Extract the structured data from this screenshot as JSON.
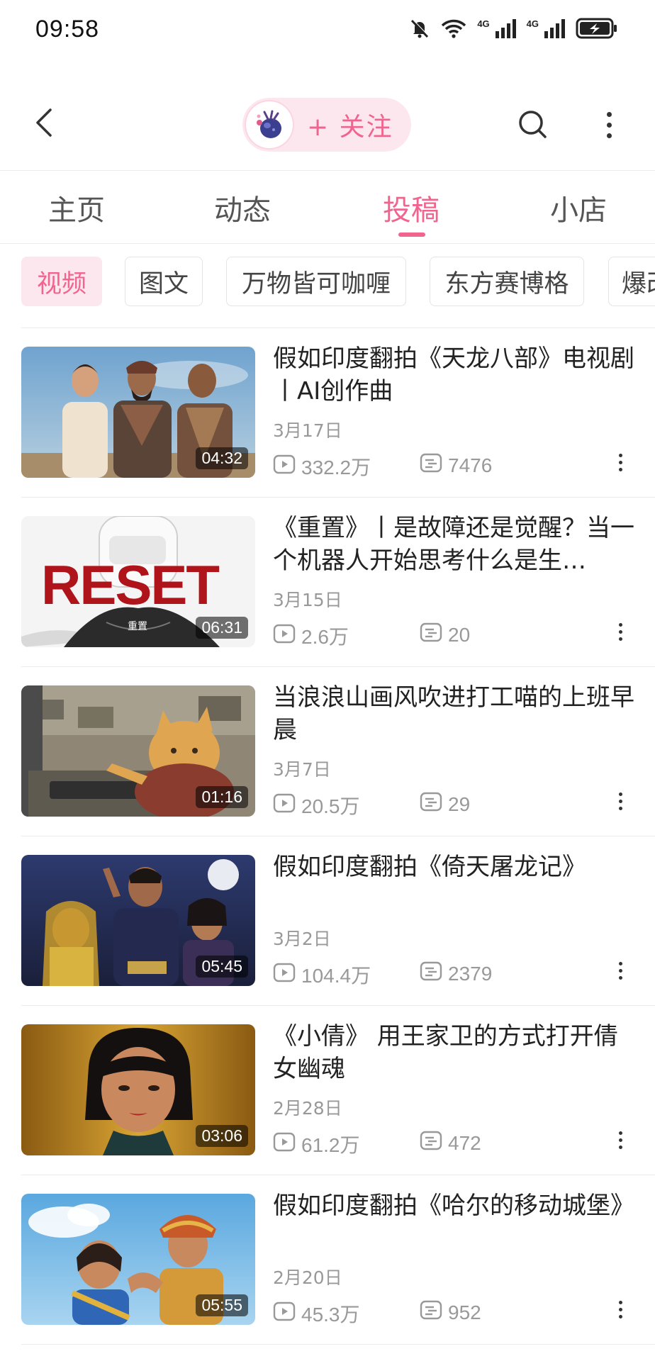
{
  "status_bar": {
    "time": "09:58",
    "network_label_1": "4G",
    "network_label_2": "4G",
    "icons": [
      "bell-off-icon",
      "wifi-icon",
      "signal-4g-icon",
      "signal-4g-icon",
      "battery-charging-icon"
    ]
  },
  "header": {
    "follow_label": "+ 关注",
    "icons": [
      "back-arrow-icon",
      "avatar-icon",
      "search-icon",
      "more-vertical-icon"
    ]
  },
  "tabs": [
    {
      "label": "主页"
    },
    {
      "label": "动态"
    },
    {
      "label": "投稿",
      "active": true
    },
    {
      "label": "小店"
    }
  ],
  "chips": [
    {
      "label": "视频",
      "active": true
    },
    {
      "label": "图文"
    },
    {
      "label": "万物皆可咖喱"
    },
    {
      "label": "东方赛博格"
    },
    {
      "label": "爆改"
    }
  ],
  "videos": [
    {
      "title": "假如印度翻拍《天龙八部》电视剧丨AI创作曲",
      "date": "3月17日",
      "duration": "04:32",
      "views": "332.2万",
      "danmaku": "7476"
    },
    {
      "title": "《重置》丨是故障还是觉醒？当一个机器人开始思考什么是生…",
      "date": "3月15日",
      "duration": "06:31",
      "views": "2.6万",
      "danmaku": "20",
      "thumb_text": "RESET",
      "thumb_subtext": "重置"
    },
    {
      "title": "当浪浪山画风吹进打工喵的上班早晨",
      "date": "3月7日",
      "duration": "01:16",
      "views": "20.5万",
      "danmaku": "29"
    },
    {
      "title": "假如印度翻拍《倚天屠龙记》",
      "date": "3月2日",
      "duration": "05:45",
      "views": "104.4万",
      "danmaku": "2379"
    },
    {
      "title": "《小倩》 用王家卫的方式打开倩女幽魂",
      "date": "2月28日",
      "duration": "03:06",
      "views": "61.2万",
      "danmaku": "472"
    },
    {
      "title": "假如印度翻拍《哈尔的移动城堡》",
      "date": "2月20日",
      "duration": "05:55",
      "views": "45.3万",
      "danmaku": "952"
    }
  ],
  "colors": {
    "accent": "#f0648e",
    "accent_bg": "#fde7ef",
    "muted_text": "#999999"
  }
}
